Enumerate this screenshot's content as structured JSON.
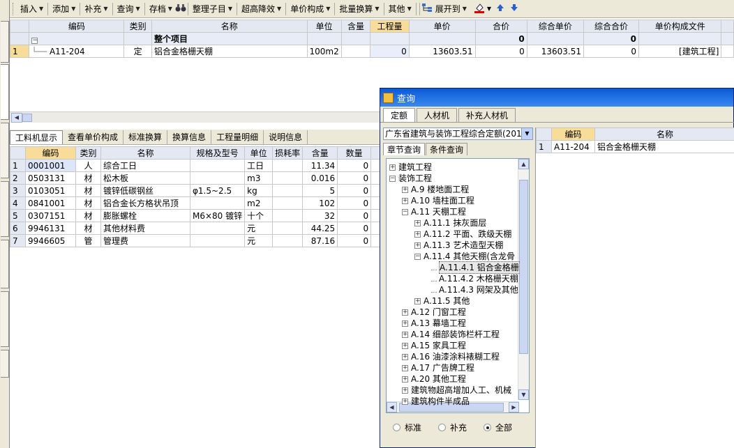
{
  "toolbar": {
    "items": [
      {
        "label": "插入",
        "dropdown": true
      },
      {
        "label": "添加",
        "dropdown": true
      },
      {
        "label": "补充",
        "dropdown": true
      },
      {
        "label": "查询",
        "dropdown": true
      },
      {
        "label": "存档",
        "dropdown": true
      },
      {
        "label": "整理子目",
        "dropdown": true
      },
      {
        "label": "超高降效",
        "dropdown": true
      },
      {
        "label": "单价构成",
        "dropdown": true
      },
      {
        "label": "批量换算",
        "dropdown": true
      },
      {
        "label": "其他",
        "dropdown": true
      },
      {
        "label": "展开到",
        "dropdown": true
      }
    ]
  },
  "top_grid": {
    "headers": [
      "编码",
      "类别",
      "名称",
      "单位",
      "含量",
      "工程量",
      "单价",
      "合价",
      "综合单价",
      "综合合价",
      "单价构成文件"
    ],
    "group_row": {
      "toggle": "−",
      "name": "整个项目",
      "total": "0",
      "comp_total": "0"
    },
    "rows": [
      {
        "rn": "1",
        "code": "A11-204",
        "type": "定",
        "name": "铝合金格栅天棚",
        "unit": "100m2",
        "qty": "",
        "amount": "0",
        "price": "13603.51",
        "total": "0",
        "comp_price": "13603.51",
        "comp_total": "0",
        "file": "[建筑工程]"
      }
    ]
  },
  "bottom_tabs": [
    "工料机显示",
    "查看单价构成",
    "标准换算",
    "换算信息",
    "工程量明细",
    "说明信息"
  ],
  "bottom_grid": {
    "headers": [
      "编码",
      "类别",
      "名称",
      "规格及型号",
      "单位",
      "损耗率",
      "含量",
      "数量"
    ],
    "rows": [
      {
        "rn": "1",
        "code": "0001001",
        "type": "人",
        "name": "综合工日",
        "spec": "",
        "unit": "工日",
        "loss": "",
        "content": "11.34",
        "qty": "0"
      },
      {
        "rn": "2",
        "code": "0503131",
        "type": "材",
        "name": "松木板",
        "spec": "",
        "unit": "m3",
        "loss": "",
        "content": "0.016",
        "qty": "0"
      },
      {
        "rn": "3",
        "code": "0103051",
        "type": "材",
        "name": "镀锌低碳钢丝",
        "spec": "φ1.5~2.5",
        "unit": "kg",
        "loss": "",
        "content": "5",
        "qty": "0"
      },
      {
        "rn": "4",
        "code": "0841001",
        "type": "材",
        "name": "铝合金长方格状吊顶",
        "spec": "",
        "unit": "m2",
        "loss": "",
        "content": "102",
        "qty": "0"
      },
      {
        "rn": "5",
        "code": "0307151",
        "type": "材",
        "name": "膨胀螺栓",
        "spec": "M6×80 镀锌",
        "unit": "十个",
        "loss": "",
        "content": "32",
        "qty": "0"
      },
      {
        "rn": "6",
        "code": "9946131",
        "type": "材",
        "name": "其他材料费",
        "spec": "",
        "unit": "元",
        "loss": "",
        "content": "44.25",
        "qty": "0"
      },
      {
        "rn": "7",
        "code": "9946605",
        "type": "管",
        "name": "管理费",
        "spec": "",
        "unit": "元",
        "loss": "",
        "content": "87.16",
        "qty": "0"
      }
    ]
  },
  "query_window": {
    "title": "查询",
    "tabs": [
      "定额",
      "人材机",
      "补充人材机"
    ],
    "combo_value": "广东省建筑与装饰工程综合定额(201",
    "subtabs": [
      "章节查询",
      "条件查询"
    ],
    "tree": [
      {
        "level": 0,
        "pm": "+",
        "text": "建筑工程"
      },
      {
        "level": 0,
        "pm": "−",
        "text": "装饰工程"
      },
      {
        "level": 1,
        "pm": "+",
        "text": "A.9 楼地面工程"
      },
      {
        "level": 1,
        "pm": "+",
        "text": "A.10 墙柱面工程"
      },
      {
        "level": 1,
        "pm": "−",
        "text": "A.11 天棚工程"
      },
      {
        "level": 2,
        "pm": "+",
        "text": "A.11.1 抹灰面层"
      },
      {
        "level": 2,
        "pm": "+",
        "text": "A.11.2 平面、跌级天棚"
      },
      {
        "level": 2,
        "pm": "+",
        "text": "A.11.3 艺术造型天棚"
      },
      {
        "level": 2,
        "pm": "−",
        "text": "A.11.4 其他天棚(含龙骨"
      },
      {
        "level": 3,
        "pm": "",
        "text": "A.11.4.1 铝合金格栅",
        "selected": true
      },
      {
        "level": 3,
        "pm": "",
        "text": "A.11.4.2 木格栅天棚"
      },
      {
        "level": 3,
        "pm": "",
        "text": "A.11.4.3 网架及其他"
      },
      {
        "level": 2,
        "pm": "+",
        "text": "A.11.5 其他"
      },
      {
        "level": 1,
        "pm": "+",
        "text": "A.12 门窗工程"
      },
      {
        "level": 1,
        "pm": "+",
        "text": "A.13 幕墙工程"
      },
      {
        "level": 1,
        "pm": "+",
        "text": "A.14 细部装饰栏杆工程"
      },
      {
        "level": 1,
        "pm": "+",
        "text": "A.15 家具工程"
      },
      {
        "level": 1,
        "pm": "+",
        "text": "A.16 油漆涂料裱糊工程"
      },
      {
        "level": 1,
        "pm": "+",
        "text": "A.17 广告牌工程"
      },
      {
        "level": 1,
        "pm": "+",
        "text": "A.20 其他工程"
      },
      {
        "level": 1,
        "pm": "+",
        "text": "建筑物超高增加人工、机械"
      },
      {
        "level": 1,
        "pm": "+",
        "text": "建筑构件半成品"
      }
    ],
    "radios": [
      {
        "label": "标准",
        "checked": false
      },
      {
        "label": "补充",
        "checked": false
      },
      {
        "label": "全部",
        "checked": true
      }
    ],
    "result_grid": {
      "headers": [
        "编码",
        "名称"
      ],
      "rows": [
        {
          "rn": "1",
          "code": "A11-204",
          "name": "铝合金格栅天棚"
        }
      ]
    }
  }
}
